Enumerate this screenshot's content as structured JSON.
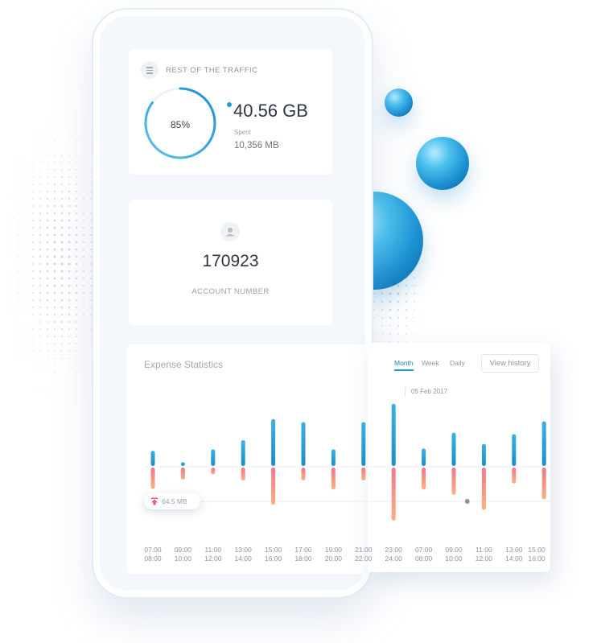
{
  "traffic_card": {
    "title": "REST OF THE TRAFFIC",
    "progress_percent": 85,
    "progress_label": "85%",
    "remaining": "40.56 GB",
    "spent_label": "Spent",
    "spent_value": "10,356 MB",
    "icon": "list-icon"
  },
  "account_card": {
    "icon": "user-icon",
    "number": "170923",
    "label": "ACCOUNT NUMBER"
  },
  "expense": {
    "title": "Expense Statistics",
    "tabs": [
      {
        "label": "Month",
        "active": true
      },
      {
        "label": "Week",
        "active": false
      },
      {
        "label": "Daily",
        "active": false
      }
    ],
    "view_history_label": "View history",
    "selected_date": "05 Feb 2017",
    "tooltip_value": "64.5 MB",
    "time_labels": [
      [
        "07:00",
        "08:00"
      ],
      [
        "09:00",
        "10:00"
      ],
      [
        "11:00",
        "12:00"
      ],
      [
        "13:00",
        "14:00"
      ],
      [
        "15:00",
        "16:00"
      ],
      [
        "17:00",
        "18:00"
      ],
      [
        "19:00",
        "20:00"
      ],
      [
        "21:00",
        "22:00"
      ],
      [
        "23:00",
        "24:00"
      ],
      [
        "07:00",
        "08:00"
      ],
      [
        "09:00",
        "10:00"
      ],
      [
        "11:00",
        "12:00"
      ],
      [
        "13:00",
        "14:00"
      ],
      [
        "15:00",
        "16:00"
      ]
    ]
  },
  "chart_data": {
    "type": "bar",
    "categories": [
      "07:00",
      "09:00",
      "11:00",
      "13:00",
      "15:00",
      "17:00",
      "19:00",
      "21:00",
      "23:00",
      "07:00",
      "09:00",
      "11:00",
      "13:00",
      "15:00"
    ],
    "series": [
      {
        "values": [
          20,
          5,
          22,
          34,
          62,
          58,
          22,
          58,
          82,
          23,
          44,
          29,
          42,
          59
        ]
      },
      {
        "values": [
          -28,
          -16,
          -9,
          -17,
          -49,
          -17,
          -29,
          -17,
          -70,
          -29,
          -36,
          -56,
          -21,
          -42
        ]
      }
    ],
    "ylim": [
      -80,
      90
    ],
    "colors": {
      "positive": "#1a8fc8",
      "negative": "#f2778f"
    }
  },
  "colors": {
    "accent": "#1e9ad6",
    "bar_top": "#3ab0e2",
    "bar_bottom_end": "#fbb07e"
  }
}
